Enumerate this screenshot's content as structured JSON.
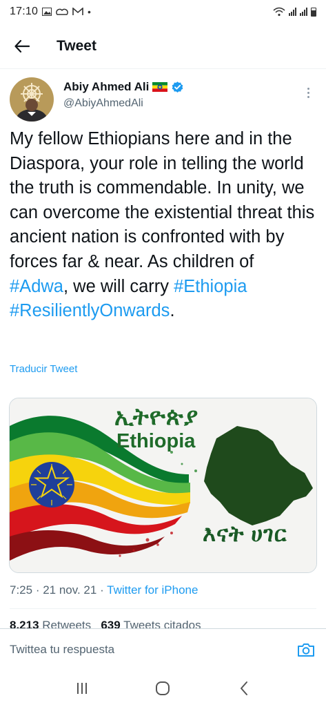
{
  "status_bar": {
    "time": "17:10",
    "left_icons": [
      "gallery-icon",
      "cloud-icon",
      "gmail-icon",
      "dot-icon"
    ],
    "right_icons": [
      "wifi-icon",
      "signal-icon",
      "signal-icon",
      "battery-icon"
    ]
  },
  "header": {
    "title": "Tweet",
    "back_icon": "arrow-left-icon"
  },
  "tweet": {
    "author_name": "Abiy Ahmed Ali",
    "handle": "@AbiyAhmedAli",
    "flag_icon": "ethiopia-flag-icon",
    "verified_icon": "verified-badge-icon",
    "text_parts": {
      "p1": "My fellow Ethiopians here and in the Diaspora, your role in telling the world the truth is commendable. In unity, we can overcome the existential threat this ancient nation is confronted with by forces far & near. As children of ",
      "h1": "#Adwa",
      "p2": ", we will carry ",
      "h2": "#Ethiopia",
      "p3": " ",
      "h3": "#ResilientlyOnwards",
      "p4": "."
    },
    "translate_label": "Traducir Tweet",
    "media": {
      "amharic_top": "ኢትዮጵያ",
      "english": "Ethiopia",
      "amharic_bottom": "እናት ሀገር"
    },
    "time": "7:25",
    "date": "21 nov. 21",
    "source": "Twitter for iPhone",
    "sep": " · ",
    "retweets_count": "8.213",
    "retweets_label": "Retweets",
    "quotes_count": "639",
    "quotes_label": "Tweets citados"
  },
  "reply": {
    "placeholder": "Twittea tu respuesta",
    "camera_icon": "camera-icon"
  },
  "colors": {
    "accent": "#1d9bf0",
    "text": "#0f1419",
    "muted": "#536471",
    "flag_green": "#078930",
    "flag_yellow": "#fcdd09",
    "flag_red": "#da121a",
    "emblem_blue": "#0f47af"
  }
}
